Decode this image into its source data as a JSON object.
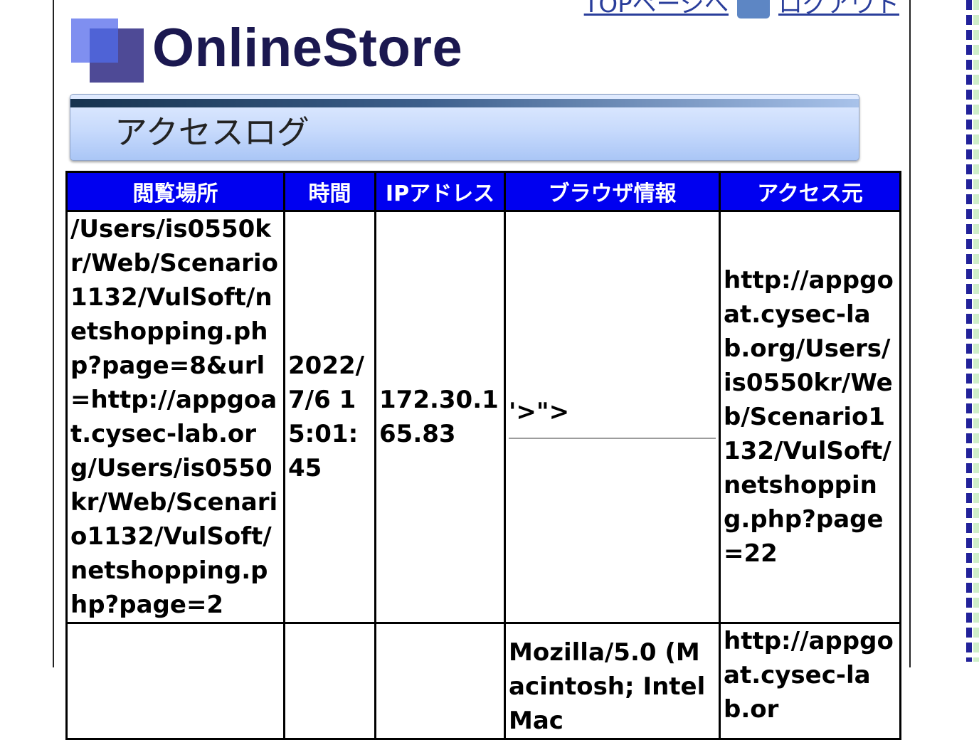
{
  "header": {
    "links": [
      {
        "label": "TOPページへ",
        "icon": "home-icon"
      },
      {
        "label": "ログアウト",
        "icon": "logout-icon"
      }
    ],
    "logo_text": "OnlineStore"
  },
  "page_title": "アクセスログ",
  "table": {
    "columns": [
      "閲覧場所",
      "時間",
      "IPアドレス",
      "ブラウザ情報",
      "アクセス元"
    ],
    "rows": [
      {
        "location": "/Users/is0550kr/Web/Scenario1132/VulSoft/netshopping.php?page=8&url=http://appgoat.cysec-lab.org/Users/is0550kr/Web/Scenario1132/VulSoft/netshopping.php?page=2",
        "time": "2022/7/6 15:01:45",
        "ip": "172.30.165.83",
        "browser": "'>\">",
        "referrer": "http://appgoat.cysec-lab.org/Users/is0550kr/Web/Scenario1132/VulSoft/netshopping.php?page=22"
      },
      {
        "location": "",
        "time": "",
        "ip": "",
        "browser": "Mozilla/5.0 (Macintosh; Intel Mac",
        "referrer": "http://appgoat.cysec-lab.or"
      }
    ]
  },
  "colors": {
    "table_header_bg": "#0000f0",
    "logo_text": "#1b1850",
    "link": "#2a3e9b"
  }
}
